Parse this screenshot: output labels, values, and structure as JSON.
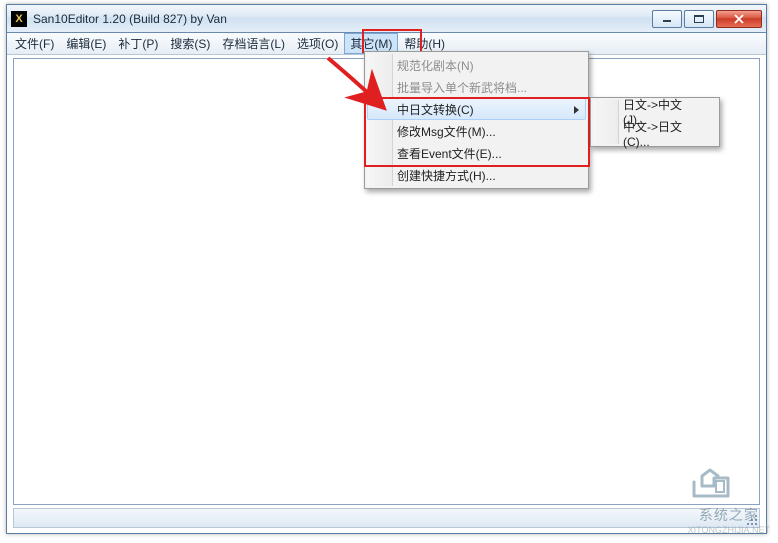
{
  "window": {
    "title": "San10Editor 1.20 (Build 827) by Van",
    "app_icon_letter": "X"
  },
  "menubar": {
    "items": [
      {
        "label": "文件(F)"
      },
      {
        "label": "编辑(E)"
      },
      {
        "label": "补丁(P)"
      },
      {
        "label": "搜索(S)"
      },
      {
        "label": "存档语言(L)"
      },
      {
        "label": "选项(O)"
      },
      {
        "label": "其它(M)"
      },
      {
        "label": "帮助(H)"
      }
    ]
  },
  "dropdown": {
    "items": [
      {
        "label": "规范化剧本(N)",
        "disabled": true
      },
      {
        "label": "批量导入单个新武将档...",
        "disabled": true
      },
      {
        "label": "中日文转换(C)",
        "submenu": true,
        "hover": true
      },
      {
        "label": "修改Msg文件(M)..."
      },
      {
        "label": "查看Event文件(E)..."
      },
      {
        "label": "创建快捷方式(H)..."
      }
    ]
  },
  "submenu": {
    "items": [
      {
        "label": "日文->中文(J)..."
      },
      {
        "label": "中文->日文(C)..."
      }
    ]
  },
  "watermark": {
    "main": "系统之家",
    "sub": "XITONGZHIJIA.NET"
  }
}
